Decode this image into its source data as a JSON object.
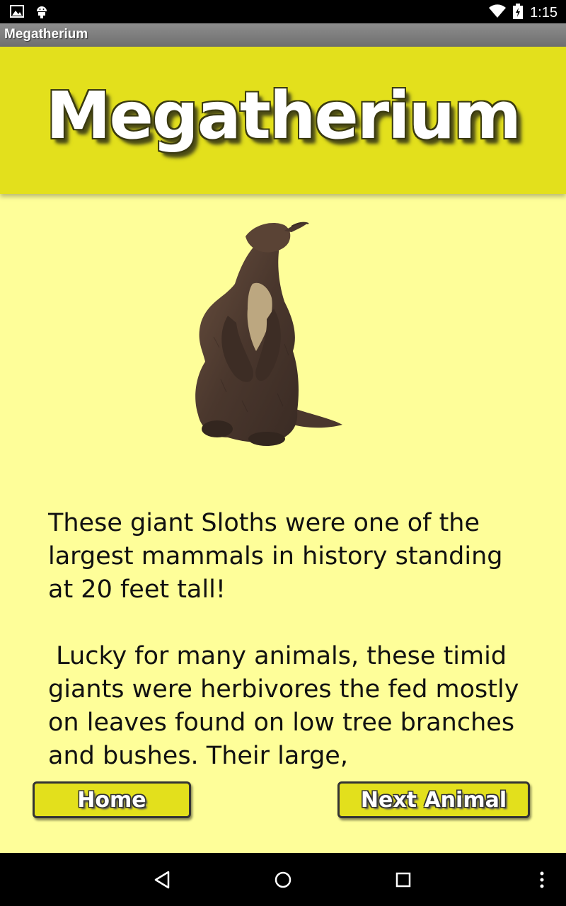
{
  "status_bar": {
    "time": "1:15",
    "left_icons": [
      "image-icon",
      "android-icon"
    ],
    "right_icons": [
      "wifi-icon",
      "battery-icon"
    ]
  },
  "action_bar": {
    "title": "Megatherium"
  },
  "header": {
    "title": "Megatherium",
    "background": "#e3e01c"
  },
  "animal_image": {
    "icon": "megatherium-illustration"
  },
  "description": {
    "text": "These giant Sloths were one of the largest mammals in history standing at 20 feet tall!\n\n Lucky for many animals, these timid giants were herbivores the fed mostly on leaves found on low tree branches and bushes. Their large,"
  },
  "buttons": {
    "home_label": "Home",
    "next_label": "Next Animal"
  },
  "nav_bar": {
    "icons": [
      "back-icon",
      "home-circle-icon",
      "recents-icon",
      "overflow-menu-icon"
    ]
  },
  "colors": {
    "page_background": "#fefe99",
    "accent_yellow": "#e3e01c"
  }
}
